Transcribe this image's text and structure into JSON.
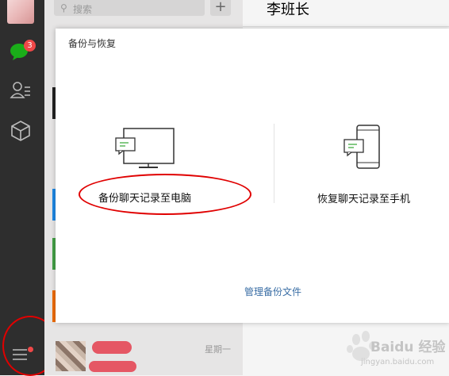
{
  "search": {
    "placeholder": "搜索"
  },
  "add_button": "+",
  "sidebar": {
    "unread_badge": "3"
  },
  "chat": {
    "title": "李班长"
  },
  "chat_list": {
    "bottom_item_time": "星期一"
  },
  "dialog": {
    "title": "备份与恢复",
    "backup_option": "备份聊天记录至电脑",
    "restore_option": "恢复聊天记录至手机",
    "manage_link": "管理备份文件"
  },
  "watermark": {
    "brand": "Baidu 经验",
    "url": "jingyan.baidu.com"
  },
  "colors": {
    "sidebar_bg": "#2e2e2e",
    "badge": "#f04848",
    "chat_green": "#1aad19",
    "annotation_red": "#e00000",
    "link": "#3a6ea5"
  }
}
